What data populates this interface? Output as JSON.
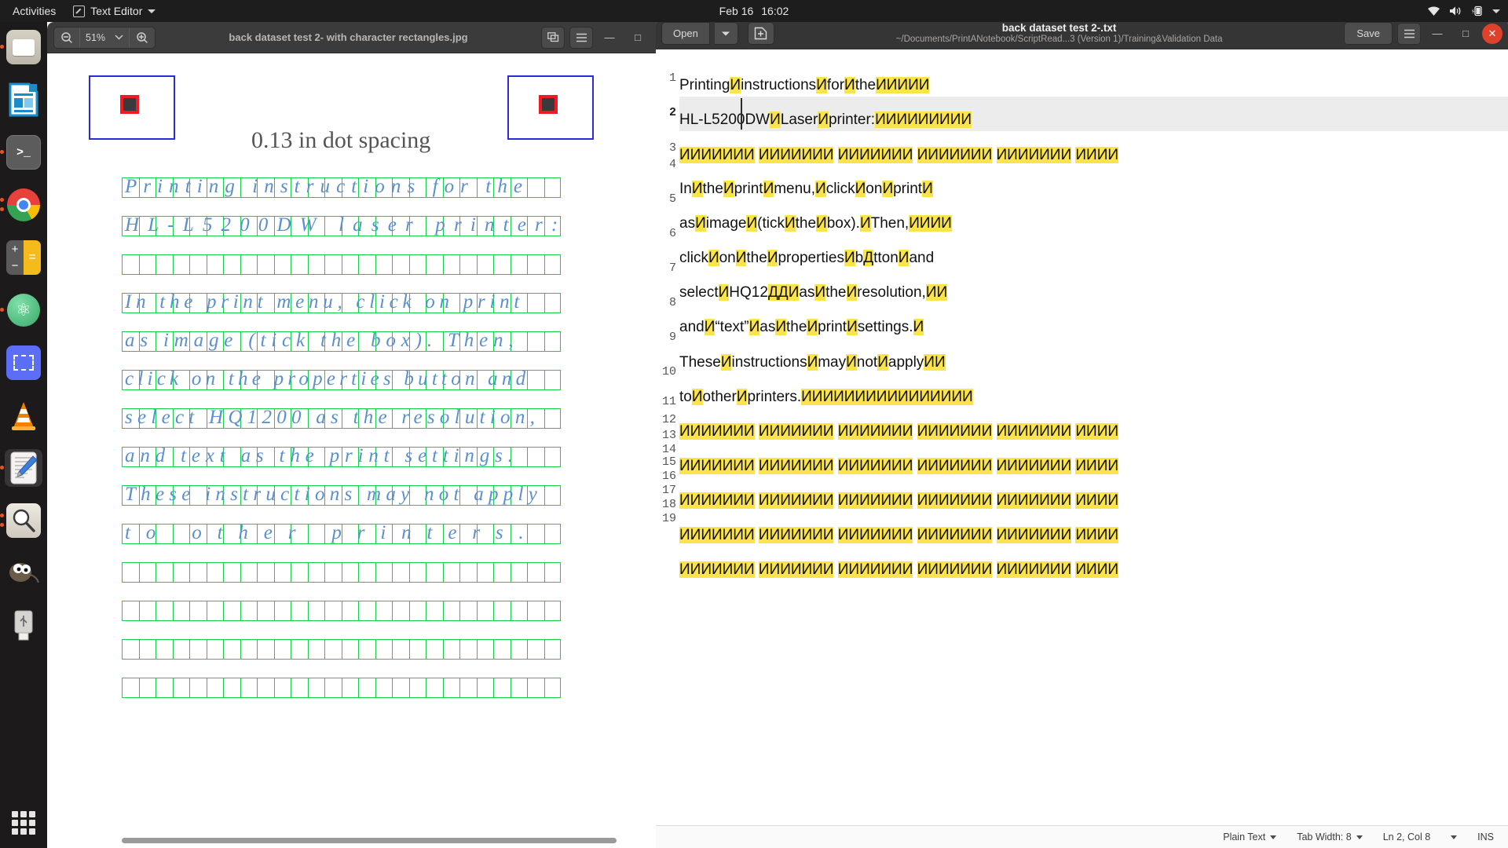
{
  "topbar": {
    "activities": "Activities",
    "app_name": "Text Editor",
    "date": "Feb 16",
    "time": "16:02",
    "icons": [
      "wifi-icon",
      "volume-icon",
      "battery-icon",
      "chevron-down-icon"
    ]
  },
  "dock": {
    "items": [
      {
        "name": "files",
        "icon": "files-icon",
        "running": true
      },
      {
        "name": "libreoffice-writer",
        "icon": "writer-icon",
        "running": false
      },
      {
        "name": "terminal",
        "icon": "terminal-icon",
        "running": true
      },
      {
        "name": "google-chrome",
        "icon": "chrome-icon",
        "running": true
      },
      {
        "name": "calculator",
        "icon": "calculator-icon",
        "running": false
      },
      {
        "name": "atom",
        "icon": "atom-icon",
        "running": true
      },
      {
        "name": "screenshot",
        "icon": "screenshot-icon",
        "running": false
      },
      {
        "name": "vlc",
        "icon": "vlc-icon",
        "running": false
      },
      {
        "name": "text-editor",
        "icon": "text-editor-icon",
        "running": true,
        "active": true
      },
      {
        "name": "image-viewer",
        "icon": "magnifier-icon",
        "running": true
      },
      {
        "name": "gimp",
        "icon": "gimp-icon",
        "running": false
      },
      {
        "name": "usb-drive",
        "icon": "usb-icon",
        "running": false
      }
    ],
    "show_apps": "show-applications"
  },
  "viewer": {
    "zoom_level": "51%",
    "title": "back dataset test 2- with character rectangles.jpg",
    "zoom_out_icon": "zoom-out-icon",
    "zoom_in_icon": "zoom-in-icon",
    "zoom_dropdown_icon": "chevron-down-icon",
    "fullscreen_icon": "fullscreen-icon",
    "menu_icon": "hamburger-menu-icon",
    "minimize_label": "—",
    "maximize_label": "□",
    "image": {
      "caption": "0.13 in dot spacing",
      "lines": [
        {
          "text": "Printing instructions for the",
          "cells": 26
        },
        {
          "text": "HL-L5200DW laser printer:",
          "cells": 26
        },
        {
          "text": "",
          "cells": 26
        },
        {
          "text": "In the print menu, click on print",
          "cells": 26
        },
        {
          "text": "as image (tick the box).  Then,",
          "cells": 26
        },
        {
          "text": "click on the properties button and",
          "cells": 26
        },
        {
          "text": "select HQ1200 as the resolution,",
          "cells": 26
        },
        {
          "text": "and text as the print settings.",
          "cells": 26
        },
        {
          "text": "These instructions may not apply",
          "cells": 26
        },
        {
          "text": "to other printers.",
          "cells": 26
        },
        {
          "text": "",
          "cells": 26
        },
        {
          "text": "",
          "cells": 26
        },
        {
          "text": "",
          "cells": 26
        },
        {
          "text": "",
          "cells": 26
        }
      ]
    }
  },
  "editor": {
    "open_label": "Open",
    "open_dropdown_icon": "chevron-down-icon",
    "new_tab_icon": "new-document-icon",
    "title": "back dataset test 2-.txt",
    "path": "~/Documents/PrintANotebook/ScriptRead...3 (Version 1)/Training&Validation Data",
    "save_label": "Save",
    "menu_icon": "hamburger-menu-icon",
    "minimize_label": "—",
    "maximize_label": "□",
    "close_label": "✕",
    "line_numbers": [
      "1",
      "2",
      "3",
      "4",
      "5",
      "6",
      "7",
      "8",
      "9",
      "10",
      "11",
      "12",
      "13",
      "14",
      "15",
      "16",
      "17",
      "18",
      "19"
    ],
    "lines": [
      "PrintingИinstructionsИforИtheИИИИИ",
      "HL-L5200DWИLaserИprinter:ИИИИИИИИИ",
      "ИИИИИИИ ИИИИИИИ ИИИИИИИ ИИИИИИИ ИИИИИИИ ИИИИ",
      "InИtheИprintИmenu,ИclickИonИprintИ",
      "asИimageИ(tickИtheИbox).ИThen,ИИИИ",
      "clickИonИtheИpropertiesИbДttonИand",
      "selectИHQ12ДДИasИtheИresolution,ИИ",
      "andИ“text”ИasИtheИprintИsettings.И",
      "TheseИinstructionsИmayИnotИapplyИИ",
      "toИotherИprinters.ИИИИИИИИИИИИИИИИ",
      "ИИИИИИИ ИИИИИИИ ИИИИИИИ ИИИИИИИ ИИИИИИИ ИИИИ",
      "ИИИИИИИ ИИИИИИИ ИИИИИИИ ИИИИИИИ ИИИИИИИ ИИИИ",
      "ИИИИИИИ ИИИИИИИ ИИИИИИИ ИИИИИИИ ИИИИИИИ ИИИИ",
      "ИИИИИИИ ИИИИИИИ ИИИИИИИ ИИИИИИИ ИИИИИИИ ИИИИ",
      "ИИИИИИИ ИИИИИИИ ИИИИИИИ ИИИИИИИ ИИИИИИИ ИИИИ"
    ],
    "current_line_index": 1
  },
  "statusbar": {
    "language": "Plain Text",
    "tab_width": "Tab Width: 8",
    "position": "Ln 2, Col 8",
    "mode": "INS",
    "language_dropdown_icon": "chevron-down-icon",
    "tab_dropdown_icon": "chevron-down-icon",
    "position_dropdown_icon": "chevron-down-icon"
  },
  "colors": {
    "highlight": "#fbe44b",
    "accent_orange": "#e95420",
    "close_red": "#e0412a",
    "grid_green": "#16d046",
    "box_blue": "#2b2bd8",
    "ink_blue": "#5a8fd0"
  }
}
